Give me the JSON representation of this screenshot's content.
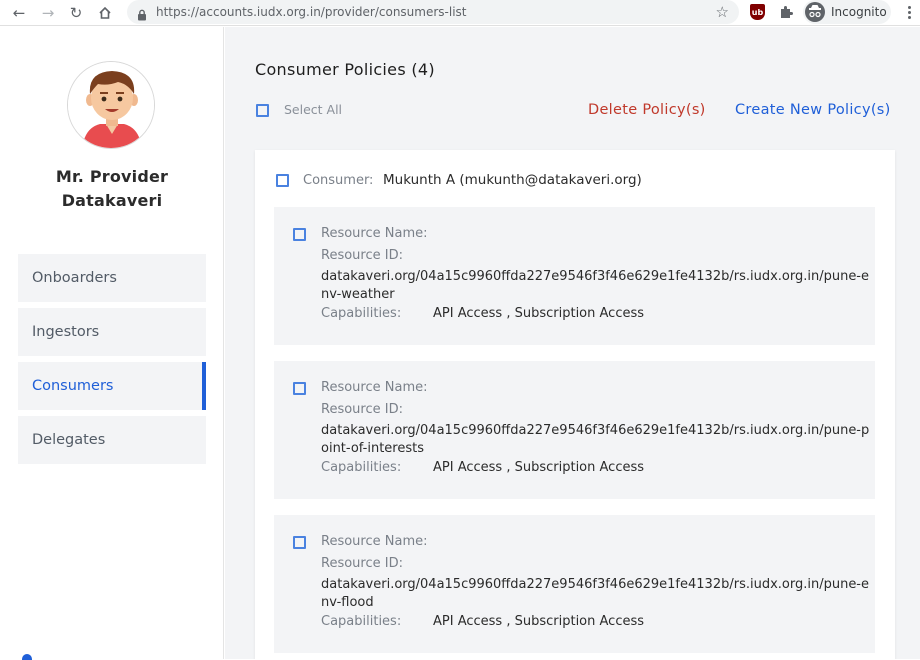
{
  "browser": {
    "url": "https://accounts.iudx.org.in/provider/consumers-list",
    "incognito_label": "Incognito",
    "ublock_label": "ub"
  },
  "sidebar": {
    "user_name_line1": "Mr. Provider",
    "user_name_line2": "Datakaveri",
    "items": [
      {
        "label": "Onboarders"
      },
      {
        "label": "Ingestors"
      },
      {
        "label": "Consumers"
      },
      {
        "label": "Delegates"
      }
    ],
    "active_item": "Consumers"
  },
  "main": {
    "title": "Consumer Policies (4)",
    "select_all_label": "Select All",
    "delete_label": "Delete Policy(s)",
    "create_label": "Create New Policy(s)",
    "consumer": {
      "label": "Consumer:",
      "value": "Mukunth A (mukunth@datakaveri.org)"
    },
    "labels": {
      "resource_name": "Resource Name:",
      "resource_id": "Resource ID:",
      "capabilities": "Capabilities:"
    },
    "resources": [
      {
        "name": "",
        "id": "datakaveri.org/04a15c9960ffda227e9546f3f46e629e1fe4132b/rs.iudx.org.in/pune-env-weather",
        "capabilities": "API Access , Subscription Access"
      },
      {
        "name": "",
        "id": "datakaveri.org/04a15c9960ffda227e9546f3f46e629e1fe4132b/rs.iudx.org.in/pune-point-of-interests",
        "capabilities": "API Access , Subscription Access"
      },
      {
        "name": "",
        "id": "datakaveri.org/04a15c9960ffda227e9546f3f46e629e1fe4132b/rs.iudx.org.in/pune-env-flood",
        "capabilities": "API Access , Subscription Access"
      }
    ]
  },
  "colors": {
    "accent": "#1f5fd8",
    "danger": "#c0392b",
    "panel_bg": "#f3f4f6"
  }
}
